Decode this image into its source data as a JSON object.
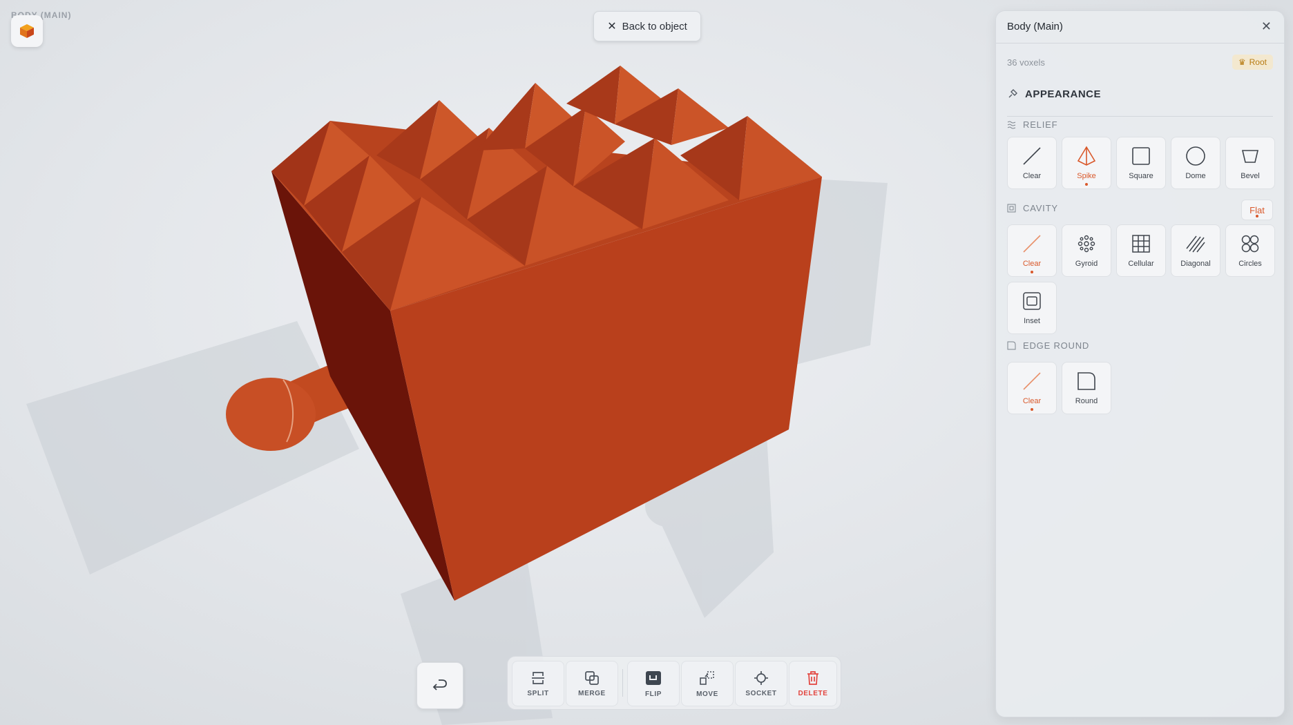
{
  "viewport": {
    "object_label": "BODY (MAIN)",
    "back_button_label": "Back to object"
  },
  "panel": {
    "title": "Body (Main)",
    "voxels": "36 voxels",
    "root_badge": "Root",
    "appearance_label": "APPEARANCE",
    "relief": {
      "label": "RELIEF",
      "selected": "Spike",
      "options": [
        "Clear",
        "Spike",
        "Square",
        "Dome",
        "Bevel"
      ]
    },
    "cavity": {
      "label": "CAVITY",
      "mode": "Flat",
      "selected": "Clear",
      "options": [
        "Clear",
        "Gyroid",
        "Cellular",
        "Diagonal",
        "Circles",
        "Inset"
      ]
    },
    "edge_round": {
      "label": "EDGE ROUND",
      "selected": "Clear",
      "options": [
        "Clear",
        "Round"
      ]
    }
  },
  "toolbar": {
    "tools": [
      "SPLIT",
      "MERGE",
      "FLIP",
      "MOVE",
      "SOCKET",
      "DELETE"
    ]
  },
  "colors": {
    "accent": "#d9582a",
    "model_orange": "#c54a23",
    "delete_red": "#e2433d",
    "root_gold": "#b77b12"
  },
  "icons": {
    "logo": "cube-icon",
    "undo": "undo-icon",
    "close": "close-icon"
  }
}
